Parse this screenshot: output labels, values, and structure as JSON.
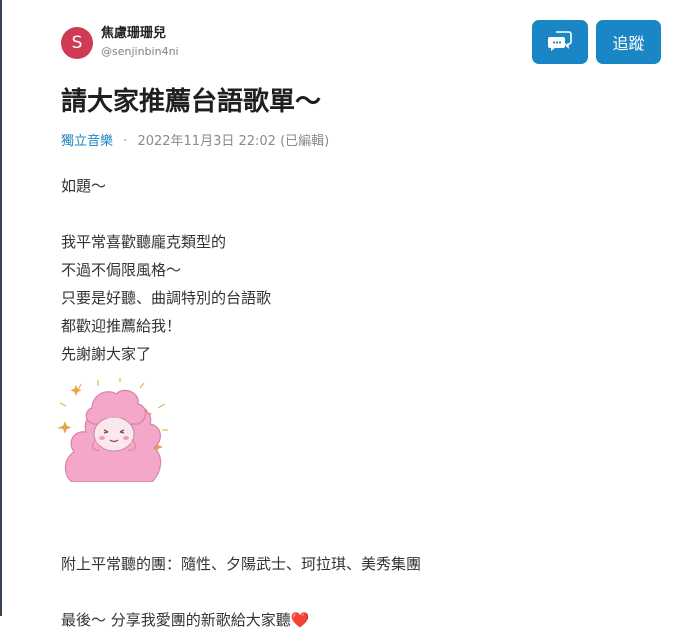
{
  "author": {
    "avatar_letter": "S",
    "name": "焦慮珊珊兒",
    "handle": "@senjinbin4ni"
  },
  "actions": {
    "chat_icon": "chat-bubble-icon",
    "follow_label": "追蹤"
  },
  "post": {
    "title": "請大家推薦台語歌單～",
    "board": "獨立音樂",
    "separator": "·",
    "date": "2022年11月3日 22:02 (已編輯)",
    "lines": {
      "l1": "如題～",
      "l2": "我平常喜歡聽龐克類型的",
      "l3": "不過不侷限風格～",
      "l4": "只要是好聽、曲調特別的台語歌",
      "l5": "都歡迎推薦給我！",
      "l6": "先謝謝大家了",
      "l7": "附上平常聽的團：隨性、夕陽武士、珂拉琪、美秀集團",
      "l8": "最後～ 分享我愛團的新歌給大家聽❤️"
    }
  },
  "colors": {
    "accent": "#1a86c6",
    "avatar": "#cf3a55",
    "sticker": "#f4a7c8"
  }
}
